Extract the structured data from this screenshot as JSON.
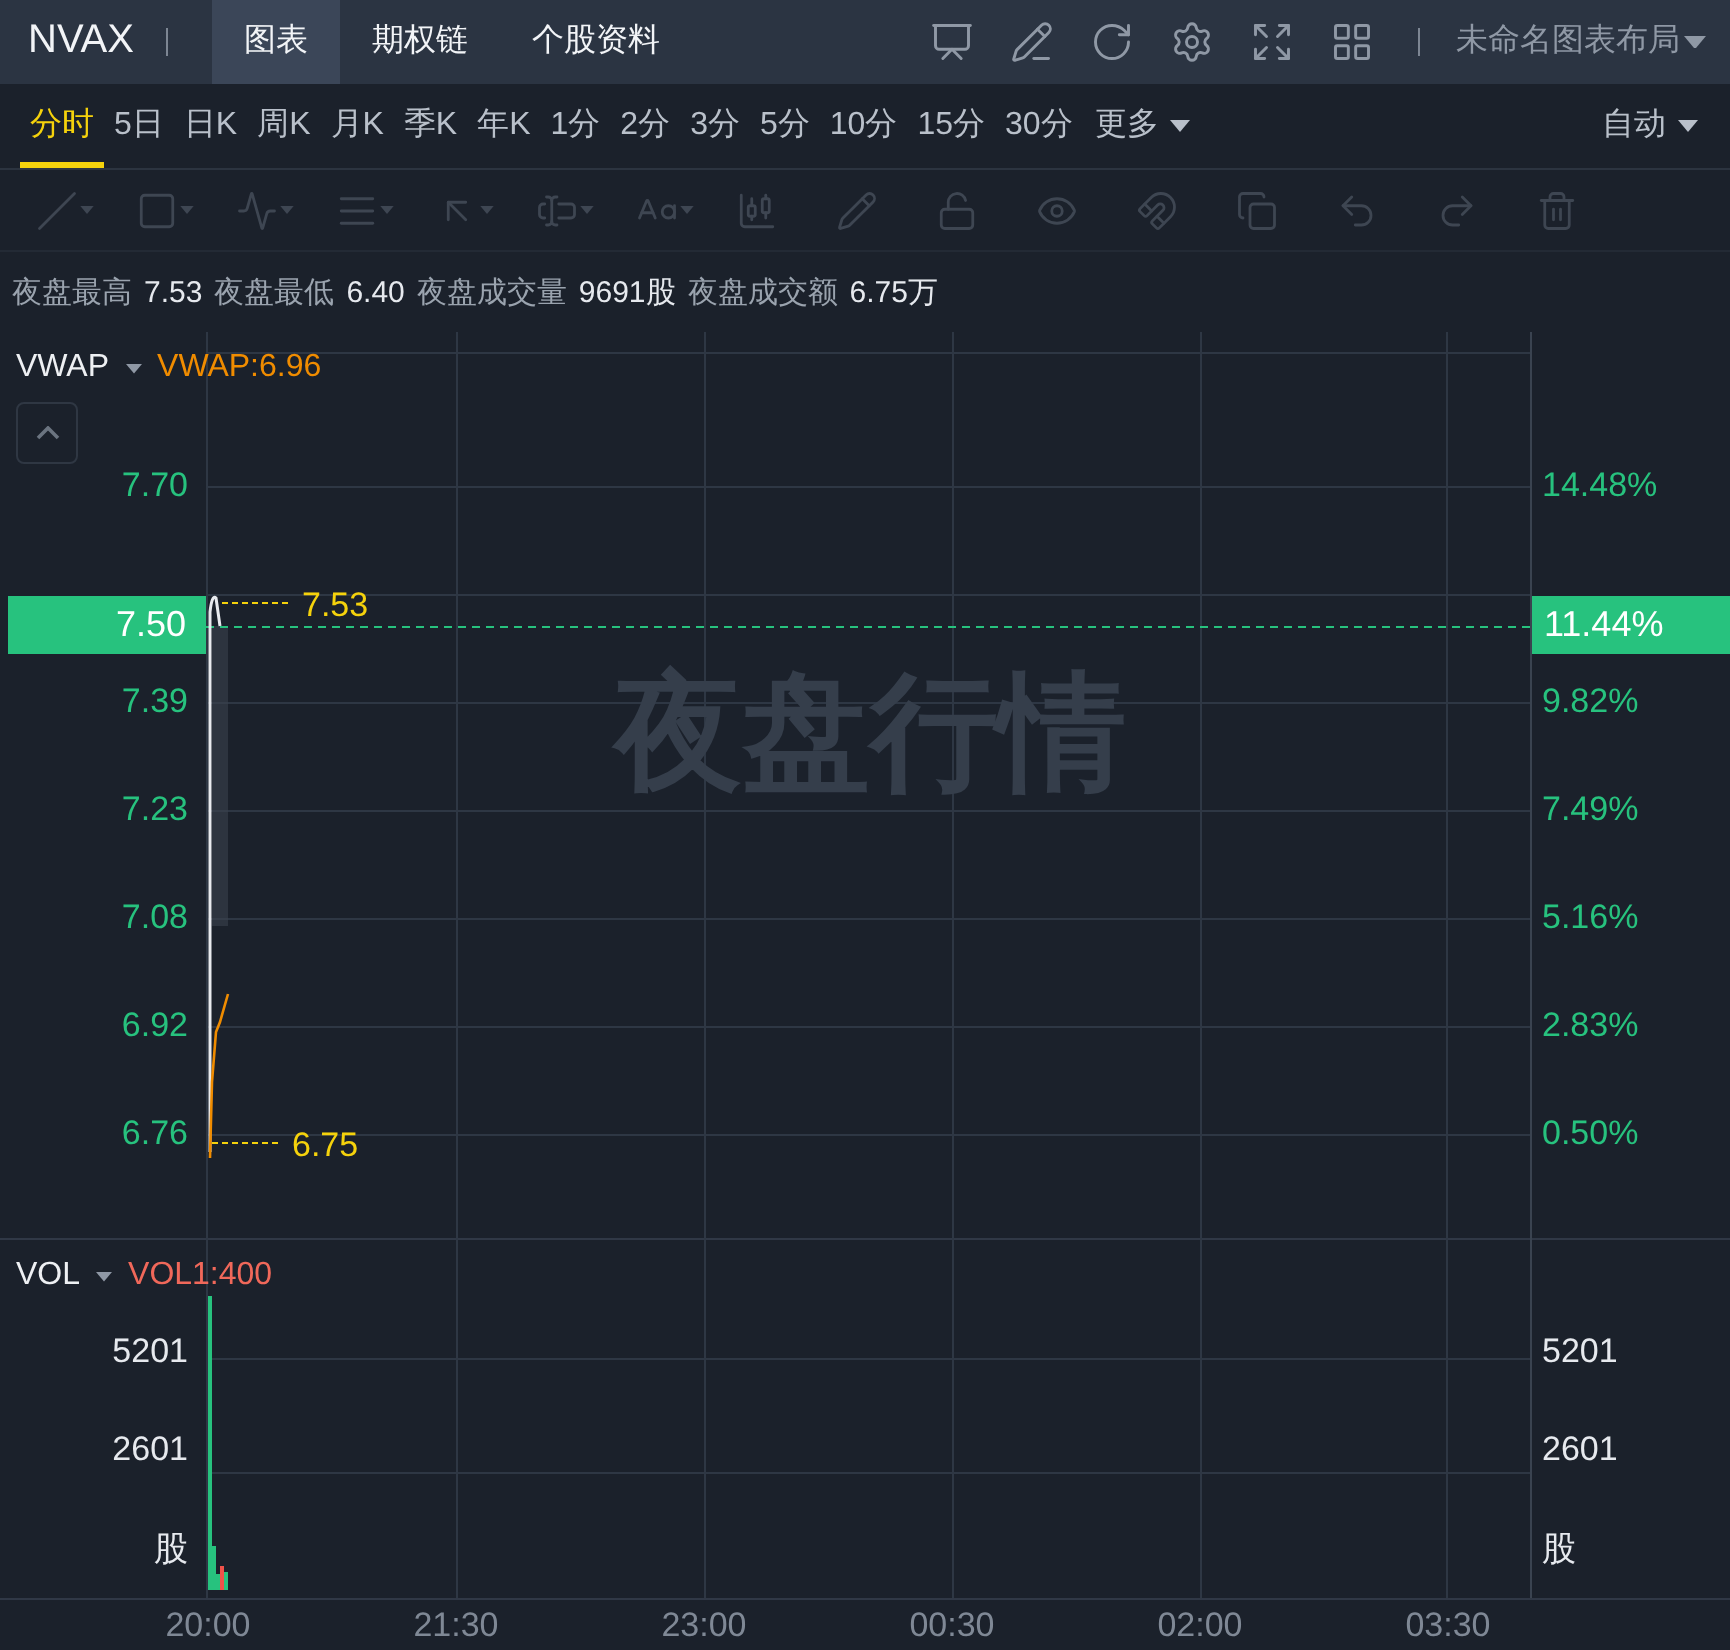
{
  "header": {
    "symbol": "NVAX",
    "tabs": [
      {
        "label": "图表",
        "selected": true
      },
      {
        "label": "期权链",
        "selected": false
      },
      {
        "label": "个股资料",
        "selected": false
      }
    ],
    "layout_menu": "未命名图表布局"
  },
  "periods": {
    "items": [
      {
        "label": "分时",
        "selected": true
      },
      {
        "label": "5日",
        "selected": false
      },
      {
        "label": "日K",
        "selected": false
      },
      {
        "label": "周K",
        "selected": false
      },
      {
        "label": "月K",
        "selected": false
      },
      {
        "label": "季K",
        "selected": false
      },
      {
        "label": "年K",
        "selected": false
      },
      {
        "label": "1分",
        "selected": false
      },
      {
        "label": "2分",
        "selected": false
      },
      {
        "label": "3分",
        "selected": false
      },
      {
        "label": "5分",
        "selected": false
      },
      {
        "label": "10分",
        "selected": false
      },
      {
        "label": "15分",
        "selected": false
      },
      {
        "label": "30分",
        "selected": false
      }
    ],
    "more": "更多",
    "mode": "自动"
  },
  "toolbar": {
    "disabled": true
  },
  "stats": [
    {
      "label": "夜盘最高",
      "value": "7.53"
    },
    {
      "label": "夜盘最低",
      "value": "6.40"
    },
    {
      "label": "夜盘成交量",
      "value": "9691股"
    },
    {
      "label": "夜盘成交额",
      "value": "6.75万"
    }
  ],
  "price_panel": {
    "indicator": "VWAP",
    "indicator_value": "VWAP:6.96",
    "watermark": "夜盘行情",
    "left_axis": [
      "7.70",
      "7.39",
      "7.23",
      "7.08",
      "6.92",
      "6.76"
    ],
    "right_axis": [
      "14.48%",
      "9.82%",
      "7.49%",
      "5.16%",
      "2.83%",
      "0.50%"
    ],
    "current_price": "7.50",
    "current_change": "11.44%",
    "high_mark": "7.53",
    "low_mark": "6.75"
  },
  "volume_panel": {
    "indicator": "VOL",
    "indicator_value": "VOL1:400",
    "left_axis": [
      "5201",
      "2601",
      "股"
    ],
    "right_axis": [
      "5201",
      "2601",
      "股"
    ]
  },
  "time_axis": [
    "20:00",
    "21:30",
    "23:00",
    "00:30",
    "02:00",
    "03:30"
  ]
}
